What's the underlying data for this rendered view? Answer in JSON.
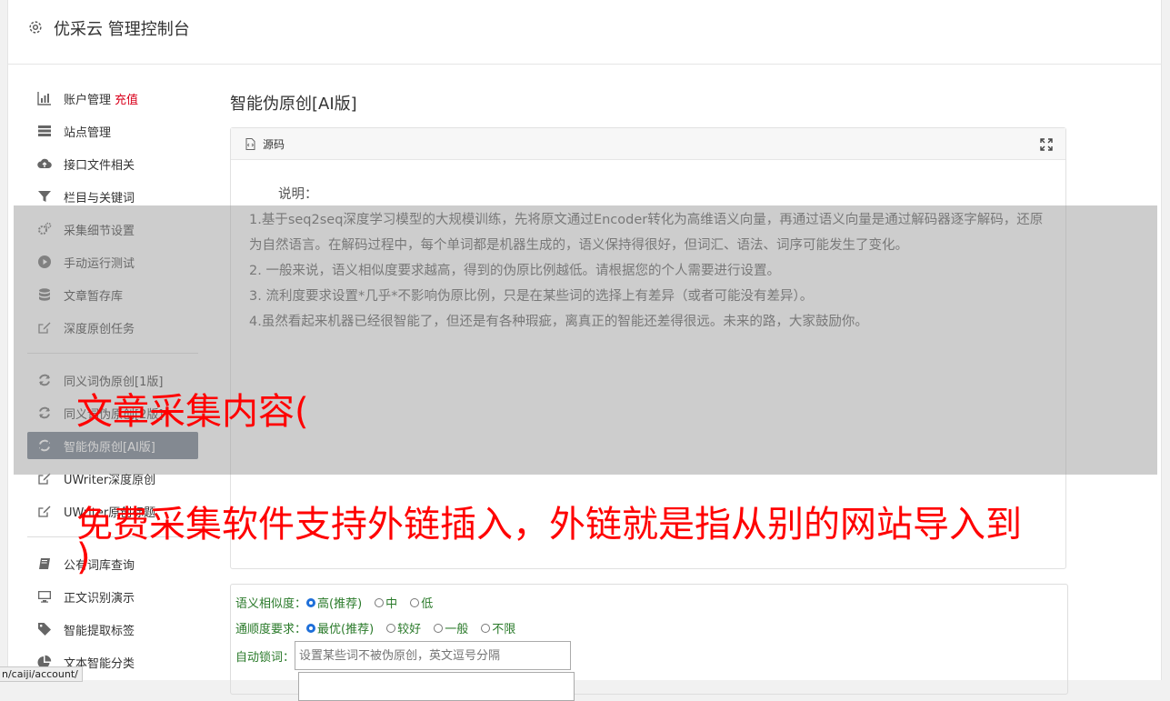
{
  "header": {
    "title": "优采云 管理控制台"
  },
  "sidebar": {
    "items_top": [
      {
        "label": "账户管理",
        "badge": "充值",
        "icon": "bar-chart-icon"
      },
      {
        "label": "站点管理",
        "icon": "server-icon"
      },
      {
        "label": "接口文件相关",
        "icon": "cloud-upload-icon"
      },
      {
        "label": "栏目与关键词",
        "icon": "filter-icon"
      },
      {
        "label": "采集细节设置",
        "icon": "gears-icon"
      },
      {
        "label": "手动运行测试",
        "icon": "play-icon"
      },
      {
        "label": "文章暂存库",
        "icon": "database-icon"
      },
      {
        "label": "深度原创任务",
        "icon": "edit-icon"
      }
    ],
    "items_mid": [
      {
        "label": "同义词伪原创[1版]",
        "icon": "refresh-icon"
      },
      {
        "label": "同义词伪原创[2版]",
        "icon": "refresh-icon"
      },
      {
        "label": "智能伪原创[AI版]",
        "icon": "refresh-icon",
        "active": true
      },
      {
        "label": "UWriter深度原创",
        "icon": "edit-icon"
      },
      {
        "label": "UWriter原创标题",
        "icon": "edit-icon"
      }
    ],
    "items_bottom": [
      {
        "label": "公有词库查询",
        "icon": "book-icon"
      },
      {
        "label": "正文识别演示",
        "icon": "monitor-icon"
      },
      {
        "label": "智能提取标签",
        "icon": "tag-icon"
      },
      {
        "label": "文本智能分类",
        "icon": "pie-chart-icon"
      }
    ]
  },
  "main": {
    "heading": "智能伪原创[AI版]",
    "panel_label": "源码",
    "desc": {
      "title": "说明：",
      "p1": "1.基于seq2seq深度学习模型的大规模训练，先将原文通过Encoder转化为高维语义向量，再通过语义向量是通过解码器逐字解码，还原为自然语言。在解码过程中，每个单词都是机器生成的，语义保持得很好，但词汇、语法、词序可能发生了变化。",
      "p2": "2. 一般来说，语义相似度要求越高，得到的伪原比例越低。请根据您的个人需要进行设置。",
      "p3": "3. 流利度要求设置*几乎*不影响伪原比例，只是在某些词的选择上有差异（或者可能没有差异）。",
      "p4": "4.虽然看起来机器已经很智能了，但还是有各种瑕疵，离真正的智能还差得很远。未来的路，大家鼓励你。"
    },
    "form": {
      "similarity_label": "语义相似度：",
      "similarity_options": [
        "高(推荐)",
        "中",
        "低"
      ],
      "fluency_label": "通顺度要求：",
      "fluency_options": [
        "最优(推荐)",
        "较好",
        "一般",
        "不限"
      ],
      "lock_label": "自动锁词：",
      "lock_placeholder": "设置某些词不被伪原创，英文逗号分隔"
    }
  },
  "overlay": {
    "line1": "文章采集内容(",
    "line2": "免费采集软件支持外链插入，外链就是指从别的网站导入到",
    "line3": ")"
  },
  "statusbar": {
    "url": "n/caiji/account/"
  },
  "colors": {
    "active_bg": "#6b7686",
    "overlay_text": "#ff0000",
    "badge": "#d9001b",
    "form_label": "#2a7a2a"
  }
}
